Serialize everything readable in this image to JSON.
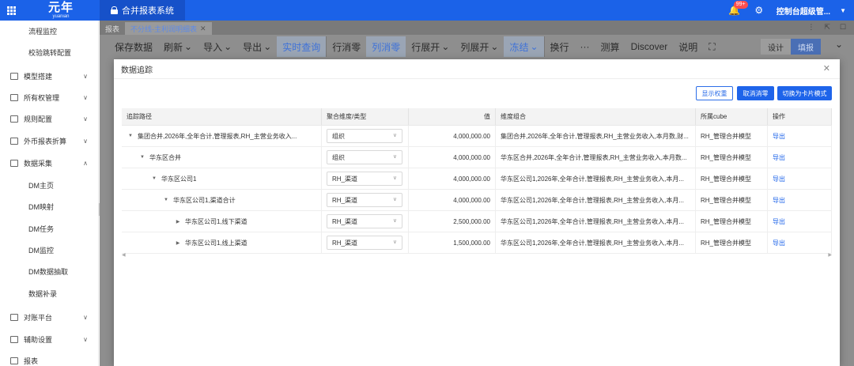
{
  "app": {
    "logo_main": "元年",
    "logo_sub": "yuanian",
    "system_tab": "合并报表系统",
    "notification_count": "99+",
    "user_name": "控制台超级管..."
  },
  "sidebar": {
    "items": [
      {
        "label": "流程监控",
        "level": 2
      },
      {
        "label": "校验跳转配置",
        "level": 2
      },
      {
        "label": "模型搭建",
        "level": 1,
        "icon": "book-icon"
      },
      {
        "label": "所有权管理",
        "level": 1,
        "icon": "book-icon"
      },
      {
        "label": "规则配置",
        "level": 1,
        "icon": "book-icon"
      },
      {
        "label": "外币报表折算",
        "level": 1,
        "icon": "book-icon"
      },
      {
        "label": "数据采集",
        "level": 1,
        "icon": "book-icon",
        "expanded": true
      },
      {
        "label": "DM主页",
        "level": 2
      },
      {
        "label": "DM映射",
        "level": 2
      },
      {
        "label": "DM任务",
        "level": 2
      },
      {
        "label": "DM监控",
        "level": 2
      },
      {
        "label": "DM数据抽取",
        "level": 2
      },
      {
        "label": "数据补录",
        "level": 2
      },
      {
        "label": "对账平台",
        "level": 1,
        "icon": "book-icon"
      },
      {
        "label": "辅助设置",
        "level": 1,
        "icon": "book-icon"
      },
      {
        "label": "报表",
        "level": 1,
        "icon": "book-icon"
      }
    ]
  },
  "tabs": [
    {
      "label": "报表",
      "active": false
    },
    {
      "label": "不分线-主利润明细表",
      "active": true
    }
  ],
  "toolbar": {
    "items": [
      "保存数据",
      "刷新",
      "导入",
      "导出",
      "实时查询",
      "行消零",
      "列消零",
      "行展开",
      "列展开",
      "冻结",
      "换行",
      "···",
      "测算",
      "Discover",
      "说明"
    ],
    "design_label": "设计",
    "fill_label": "填报"
  },
  "modal": {
    "title": "数据追踪",
    "btn_show_weight": "显示权重",
    "btn_cancel_zero": "取消消零",
    "btn_switch_card": "切换为卡片模式",
    "columns": [
      "追踪路径",
      "聚合维度/类型",
      "值",
      "维度组合",
      "所属cube",
      "操作"
    ],
    "rows": [
      {
        "path": "集团合并,2026年,全年合计,管理报表,RH_主营业务收入...",
        "level": 0,
        "toggle": "▼",
        "agg": "组织",
        "value": "4,000,000.00",
        "combo": "集团合并,2026年,全年合计,管理报表,RH_主营业务收入,本月数,财...",
        "cube": "RH_管理合并模型",
        "action": "导出"
      },
      {
        "path": "华东区合并",
        "level": 1,
        "toggle": "▼",
        "agg": "组织",
        "value": "4,000,000.00",
        "combo": "华东区合并,2026年,全年合计,管理报表,RH_主营业务收入,本月数...",
        "cube": "RH_管理合并模型",
        "action": "导出"
      },
      {
        "path": "华东区公司1",
        "level": 2,
        "toggle": "▼",
        "agg": "RH_渠道",
        "value": "4,000,000.00",
        "combo": "华东区公司1,2026年,全年合计,管理报表,RH_主营业务收入,本月...",
        "cube": "RH_管理合并模型",
        "action": "导出"
      },
      {
        "path": "华东区公司1,渠道合计",
        "level": 3,
        "toggle": "▼",
        "agg": "RH_渠道",
        "value": "4,000,000.00",
        "combo": "华东区公司1,2026年,全年合计,管理报表,RH_主营业务收入,本月...",
        "cube": "RH_管理合并模型",
        "action": "导出"
      },
      {
        "path": "华东区公司1,线下渠道",
        "level": 4,
        "toggle": "▶",
        "agg": "RH_渠道",
        "value": "2,500,000.00",
        "combo": "华东区公司1,2026年,全年合计,管理报表,RH_主营业务收入,本月...",
        "cube": "RH_管理合并模型",
        "action": "导出"
      },
      {
        "path": "华东区公司1,线上渠道",
        "level": 4,
        "toggle": "▶",
        "agg": "RH_渠道",
        "value": "1,500,000.00",
        "combo": "华东区公司1,2026年,全年合计,管理报表,RH_主营业务收入,本月...",
        "cube": "RH_管理合并模型",
        "action": "导出"
      }
    ]
  }
}
